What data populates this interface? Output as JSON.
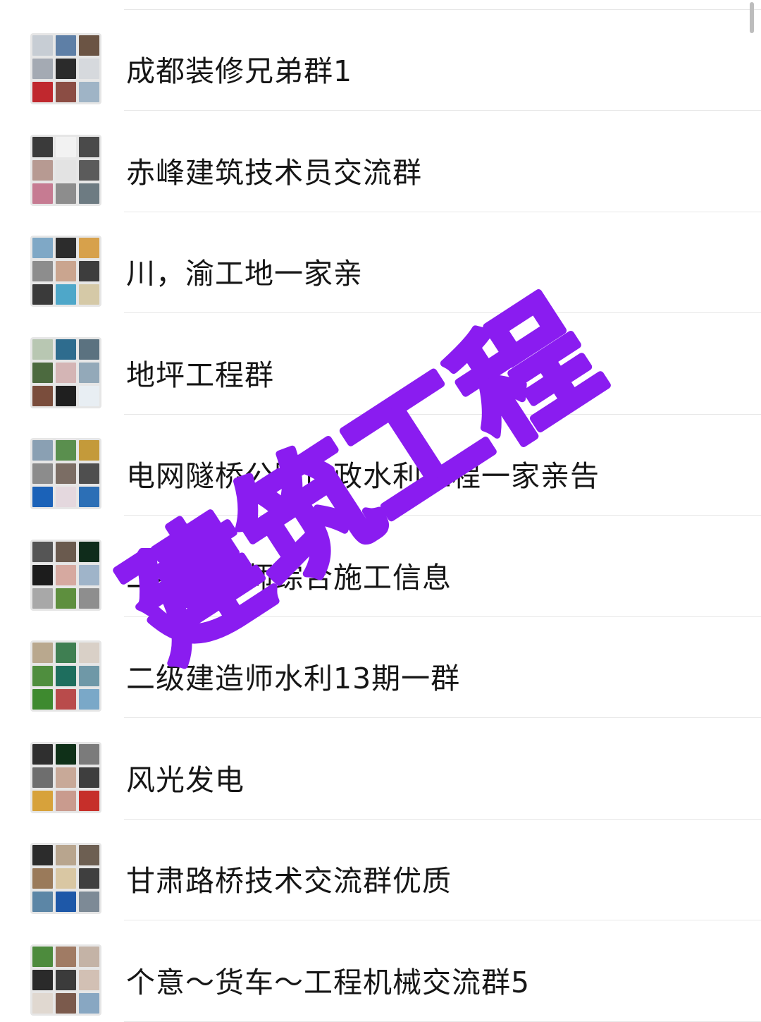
{
  "groups": [
    {
      "name": "成都装修兄弟群1",
      "tiles": [
        "#c7cdd4",
        "#5e7fa6",
        "#6b5444",
        "#a4aab3",
        "#2b2b2b",
        "#d6d9dd",
        "#c0282e",
        "#8b4d44",
        "#9fb4c6"
      ]
    },
    {
      "name": "赤峰建筑技术员交流群",
      "tiles": [
        "#3a3a3a",
        "#f2f2f2",
        "#4a4a4a",
        "#b79a92",
        "#e3e3e3",
        "#5b5b5b",
        "#c67b92",
        "#8d8d8d",
        "#6d7b82"
      ]
    },
    {
      "name": "川，渝工地一家亲",
      "tiles": [
        "#7fa8c6",
        "#2c2c2c",
        "#d7a14b",
        "#8d8d8d",
        "#caa58f",
        "#3d3d3d",
        "#3a3a3a",
        "#4ea7c9",
        "#d5c9a7"
      ]
    },
    {
      "name": "地坪工程群",
      "tiles": [
        "#b8c7b2",
        "#2e6c8e",
        "#5b7280",
        "#4c6a3f",
        "#d4b5b5",
        "#93a9b9",
        "#7a4d3c",
        "#1f1f1f",
        "#e8eef3"
      ]
    },
    {
      "name": "电网隧桥公路市政水利工程一家亲告",
      "tiles": [
        "#8aa0b3",
        "#5a8f4e",
        "#c49a3a",
        "#8c8c8c",
        "#7b6d64",
        "#4f4f4f",
        "#1b62b8",
        "#e4d8de",
        "#2c6fb6"
      ]
    },
    {
      "name": "二级建造师综合施工信息",
      "tiles": [
        "#555555",
        "#6a5a4e",
        "#0f2c1b",
        "#1c1c1c",
        "#d6a9a0",
        "#9fb4c9",
        "#a8a8a8",
        "#5e8f3e",
        "#8e8e8e"
      ]
    },
    {
      "name": "二级建造师水利13期一群",
      "tiles": [
        "#b9a88e",
        "#3f7f52",
        "#d9d0c7",
        "#4f8e3e",
        "#1e6e5e",
        "#6f98a7",
        "#3e8a2f",
        "#b94b4b",
        "#7aa8c8"
      ]
    },
    {
      "name": "风光发电",
      "tiles": [
        "#2f2f2f",
        "#0f3018",
        "#7b7b7b",
        "#6e6e6e",
        "#c8a998",
        "#3e3e3e",
        "#d7a23b",
        "#c99b8e",
        "#c62f2a"
      ]
    },
    {
      "name": "甘肃路桥技术交流群优质",
      "tiles": [
        "#2c2c2c",
        "#b8a58e",
        "#6d5f52",
        "#9a7a5a",
        "#d9c7a3",
        "#3f3f3f",
        "#5c86a6",
        "#1e58a8",
        "#7d8a96"
      ]
    },
    {
      "name": "个意～货车～工程机械交流群5",
      "tiles": [
        "#4d8b3d",
        "#a07b64",
        "#c4b3a6",
        "#2a2a2a",
        "#3b3b3b",
        "#d2c0b4",
        "#e0d8d0",
        "#7b5a4c",
        "#88a7c2"
      ]
    }
  ],
  "watermark_text": "建筑工程",
  "colors": {
    "watermark": "#8a1cf0",
    "divider": "#e7e7e7"
  }
}
